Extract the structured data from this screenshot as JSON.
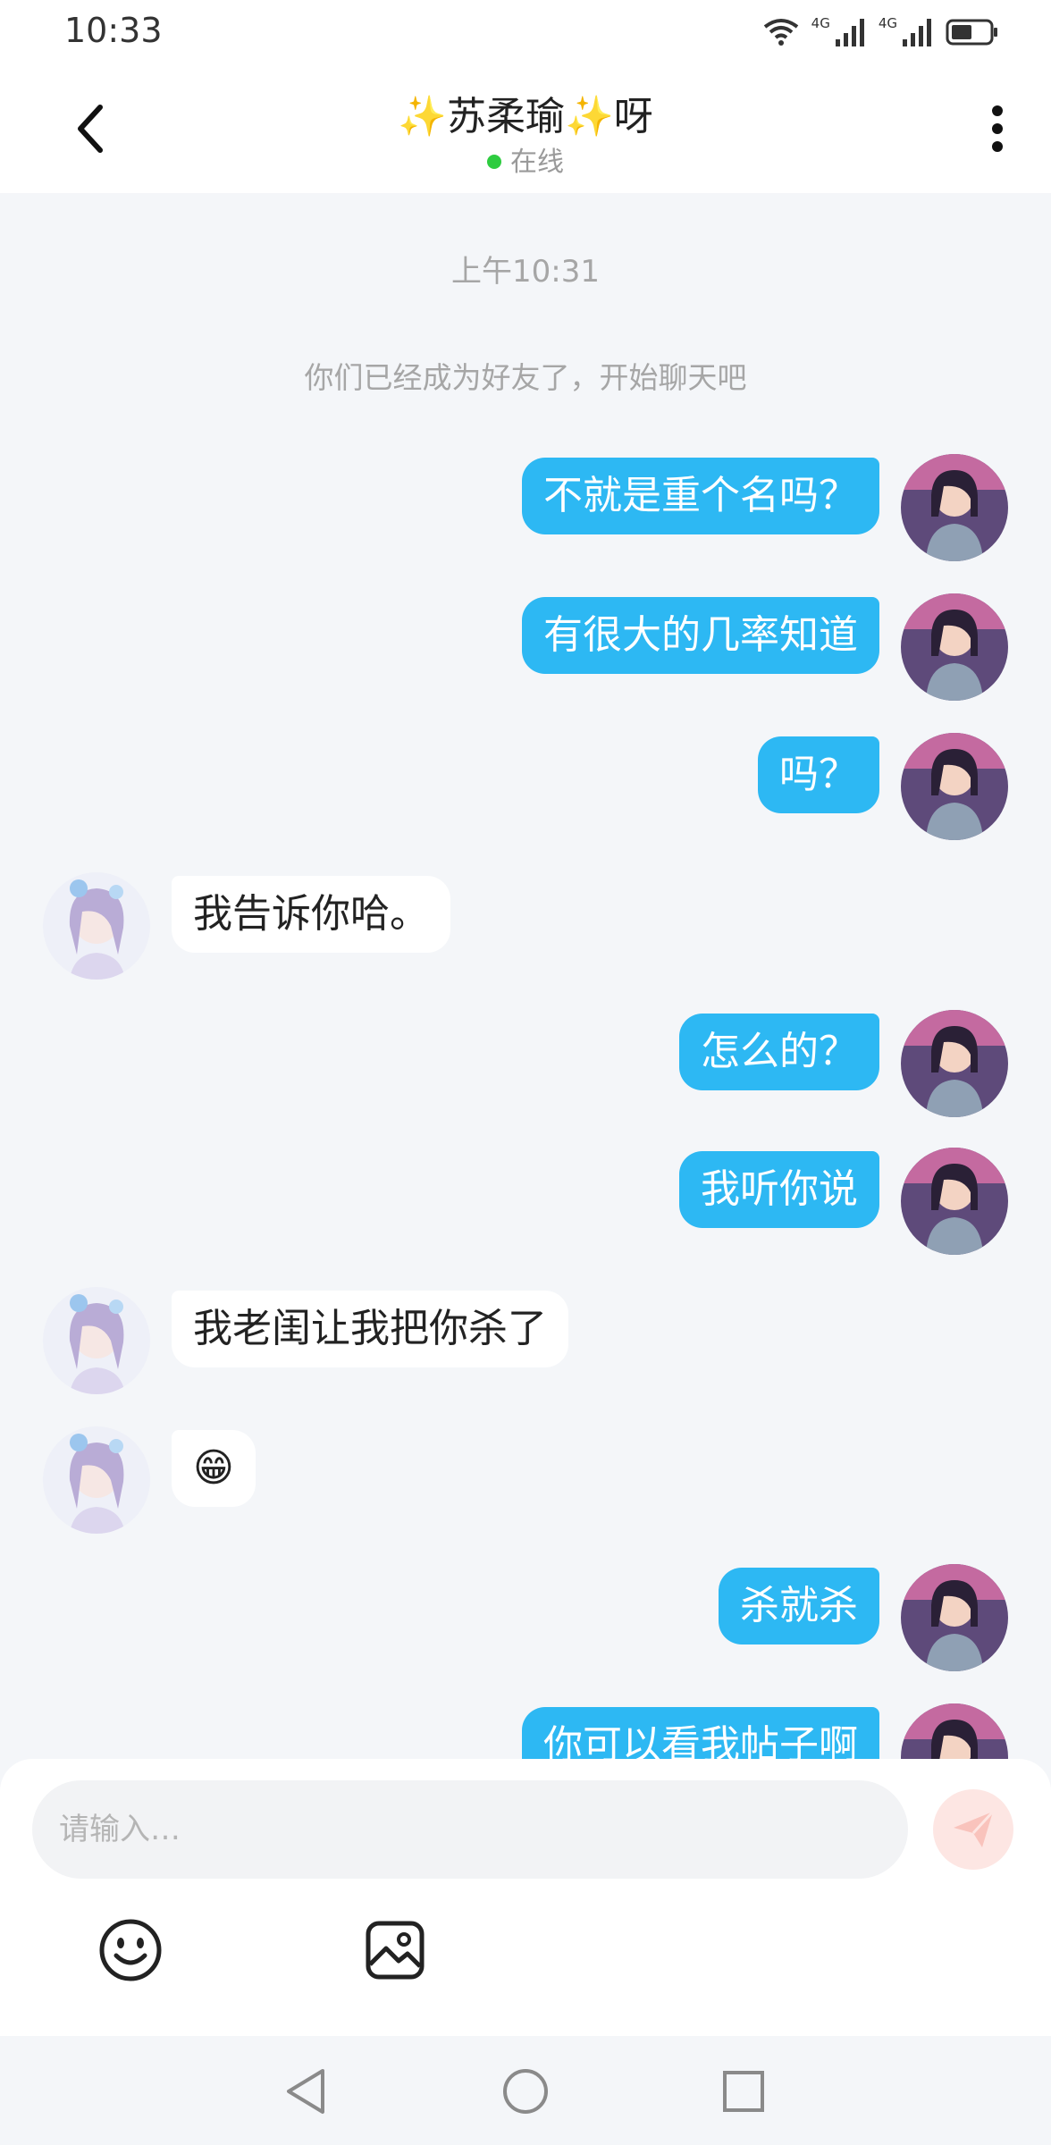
{
  "status_bar": {
    "time": "10:33",
    "network_1": "4G",
    "network_2": "4G"
  },
  "header": {
    "title": "✨苏柔瑜✨呀",
    "status": "在线",
    "back_icon": "chevron-left-icon",
    "more_icon": "more-vertical-icon"
  },
  "chat": {
    "time_separator": "上午10:31",
    "system_message": "你们已经成为好友了，开始聊天吧",
    "messages": [
      {
        "side": "right",
        "text": "不就是重个名吗？"
      },
      {
        "side": "right",
        "text": "有很大的几率知道"
      },
      {
        "side": "right",
        "text": "吗？"
      },
      {
        "side": "left",
        "text": "我告诉你哈。"
      },
      {
        "side": "right",
        "text": "怎么的？"
      },
      {
        "side": "right",
        "text": "我听你说"
      },
      {
        "side": "left",
        "text": "我老闺让我把你杀了"
      },
      {
        "side": "left",
        "text": "😁"
      },
      {
        "side": "right",
        "text": "杀就杀"
      },
      {
        "side": "right",
        "text": "你可以看我帖子啊"
      }
    ]
  },
  "input": {
    "placeholder": "请输入…",
    "value": ""
  },
  "toolbar": {
    "emoji_icon": "emoji-icon",
    "image_icon": "image-icon",
    "send_icon": "send-icon"
  },
  "nav": {
    "back_icon": "nav-back-icon",
    "home_icon": "nav-home-icon",
    "recent_icon": "nav-recent-icon"
  },
  "colors": {
    "accent": "#2db8f3",
    "chat_background": "#f4f6f9",
    "online_dot": "#2ecc40",
    "send_button": "#fde6e3"
  }
}
